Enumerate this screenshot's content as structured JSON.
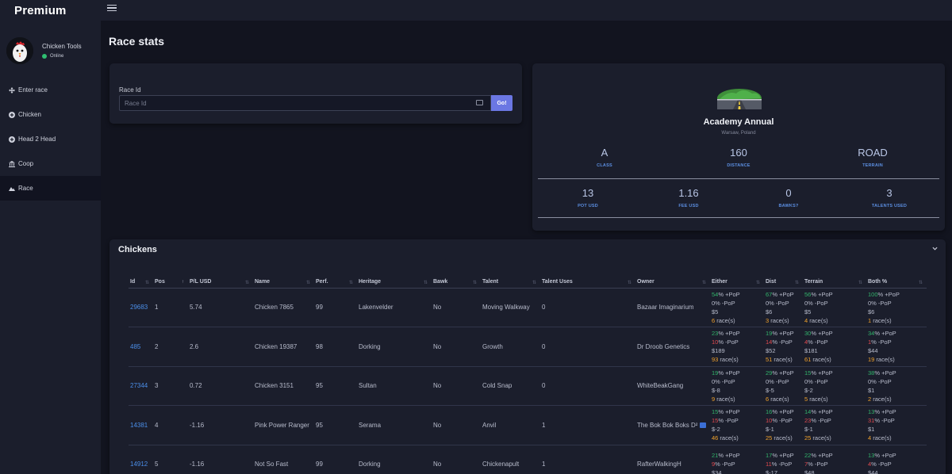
{
  "brand": "Premium",
  "profile": {
    "name": "Chicken Tools",
    "status": "Online"
  },
  "nav": [
    {
      "label": "Enter race",
      "icon": "plus-arrows-icon"
    },
    {
      "label": "Chicken",
      "icon": "plus-circle-icon"
    },
    {
      "label": "Head 2 Head",
      "icon": "plus-circle-icon"
    },
    {
      "label": "Coop",
      "icon": "bank-icon"
    },
    {
      "label": "Race",
      "icon": "mountain-icon"
    }
  ],
  "page_title": "Race stats",
  "race_id": {
    "label": "Race Id",
    "placeholder": "Race Id",
    "value": "",
    "button": "Go!"
  },
  "race": {
    "name": "Academy Annual",
    "location": "Warsaw, Poland",
    "stats_top": [
      {
        "value": "A",
        "label": "CLASS"
      },
      {
        "value": "160",
        "label": "DISTANCE"
      },
      {
        "value": "ROAD",
        "label": "TERRAIN"
      }
    ],
    "stats_bottom": [
      {
        "value": "13",
        "label": "POT USD"
      },
      {
        "value": "1.16",
        "label": "FEE USD"
      },
      {
        "value": "0",
        "label": "BAWKS?"
      },
      {
        "value": "3",
        "label": "TALENTS USED"
      }
    ]
  },
  "chickens": {
    "title": "Chickens",
    "columns": [
      "Id",
      "Pos",
      "P/L USD",
      "Name",
      "Perf.",
      "Heritage",
      "Bawk",
      "Talent",
      "Talent Uses",
      "Owner",
      "Either",
      "Dist",
      "Terrain",
      "Both %"
    ],
    "rows": [
      {
        "id": "29683",
        "pos": "1",
        "pl": "5.74",
        "name": "Chicken 7865",
        "perf": "99",
        "heritage": "Lakenvelder",
        "bawk": "No",
        "talent": "Moving Walkway",
        "uses": "0",
        "owner": "Bazaar Imaginarium",
        "either": [
          "54",
          "0",
          "$5",
          "6"
        ],
        "dist": [
          "67",
          "0",
          "$6",
          "3"
        ],
        "terrain": [
          "56",
          "0",
          "$5",
          "4"
        ],
        "both": [
          "100",
          "0",
          "$6",
          "1"
        ]
      },
      {
        "id": "485",
        "pos": "2",
        "pl": "2.6",
        "name": "Chicken 19387",
        "perf": "98",
        "heritage": "Dorking",
        "bawk": "No",
        "talent": "Growth",
        "uses": "0",
        "owner": "Dr Droob Genetics",
        "either": [
          "23",
          "10",
          "$189",
          "93"
        ],
        "dist": [
          "19",
          "14",
          "$52",
          "51"
        ],
        "terrain": [
          "30",
          "4",
          "$181",
          "61"
        ],
        "both": [
          "34",
          "1",
          "$44",
          "19"
        ]
      },
      {
        "id": "27344",
        "pos": "3",
        "pl": "0.72",
        "name": "Chicken 3151",
        "perf": "95",
        "heritage": "Sultan",
        "bawk": "No",
        "talent": "Cold Snap",
        "uses": "0",
        "owner": "WhiteBeakGang",
        "either": [
          "19",
          "0",
          "$-8",
          "9"
        ],
        "dist": [
          "29",
          "0",
          "$-5",
          "6"
        ],
        "terrain": [
          "15",
          "0",
          "$-2",
          "5"
        ],
        "both": [
          "38",
          "0",
          "$1",
          "2"
        ]
      },
      {
        "id": "14381",
        "pos": "4",
        "pl": "-1.16",
        "name": "Pink Power Ranger",
        "perf": "95",
        "heritage": "Serama",
        "bawk": "No",
        "talent": "Anvil",
        "uses": "1",
        "owner": "The Bok Bok Boks D²",
        "either": [
          "15",
          "15",
          "$-2",
          "46"
        ],
        "dist": [
          "16",
          "10",
          "$-1",
          "25"
        ],
        "terrain": [
          "14",
          "23",
          "$-1",
          "25"
        ],
        "both": [
          "13",
          "31",
          "$1",
          "4"
        ]
      },
      {
        "id": "14912",
        "pos": "5",
        "pl": "-1.16",
        "name": "Not So Fast",
        "perf": "99",
        "heritage": "Dorking",
        "bawk": "No",
        "talent": "Chickenapult",
        "uses": "1",
        "owner": "RafterWalkingH",
        "either": [
          "21",
          "9",
          "$34",
          ""
        ],
        "dist": [
          "17",
          "11",
          "$-17",
          ""
        ],
        "terrain": [
          "22",
          "7",
          "$48",
          ""
        ],
        "both": [
          "13",
          "4",
          "$44",
          ""
        ]
      }
    ],
    "labels": {
      "pop_plus": "% +PoP",
      "pop_minus": "% -PoP",
      "races": " race(s)"
    }
  },
  "colors": {
    "accent": "#6b77e3",
    "link": "#4b8ee8",
    "green": "#32b36b",
    "red": "#e04a4f",
    "orange": "#f0a12b",
    "online": "#2fbf71"
  }
}
